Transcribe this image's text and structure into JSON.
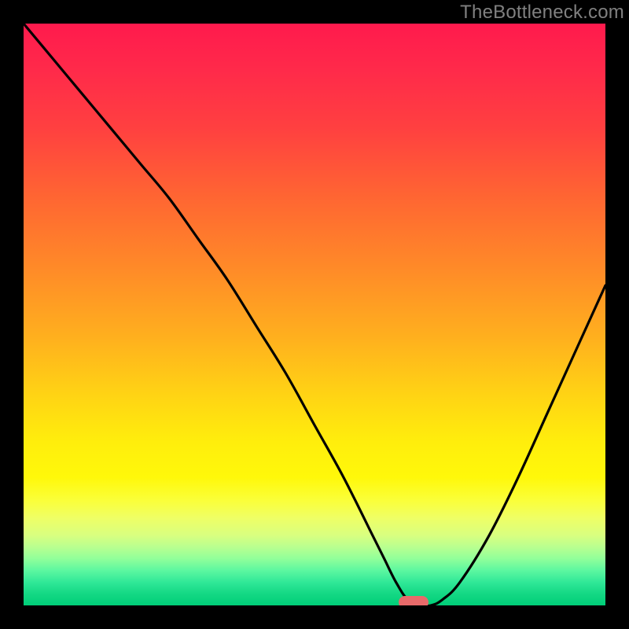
{
  "watermark": "TheBottleneck.com",
  "colors": {
    "frame": "#000000",
    "curve": "#000000",
    "marker": "#e86a6a",
    "watermark": "#808080"
  },
  "chart_data": {
    "type": "line",
    "title": "",
    "xlabel": "",
    "ylabel": "",
    "xlim": [
      0,
      100
    ],
    "ylim": [
      0,
      100
    ],
    "grid": false,
    "legend": false,
    "series": [
      {
        "name": "bottleneck-curve",
        "x": [
          0,
          5,
          10,
          15,
          20,
          25,
          30,
          35,
          40,
          45,
          50,
          55,
          60,
          62,
          64,
          66,
          68,
          70,
          72,
          75,
          80,
          85,
          90,
          95,
          100
        ],
        "values": [
          100,
          94,
          88,
          82,
          76,
          70,
          63,
          56,
          48,
          40,
          31,
          22,
          12,
          8,
          4,
          1,
          0,
          0,
          1,
          4,
          12,
          22,
          33,
          44,
          55
        ]
      }
    ],
    "annotations": [
      {
        "name": "optimal-marker",
        "x": 67,
        "y": 0,
        "shape": "pill",
        "color": "#e86a6a"
      }
    ],
    "background": {
      "type": "vertical-gradient",
      "stops": [
        {
          "pct": 0,
          "color": "#ff1a4d"
        },
        {
          "pct": 50,
          "color": "#ffb01e"
        },
        {
          "pct": 78,
          "color": "#fff80a"
        },
        {
          "pct": 100,
          "color": "#00ce78"
        }
      ]
    }
  }
}
